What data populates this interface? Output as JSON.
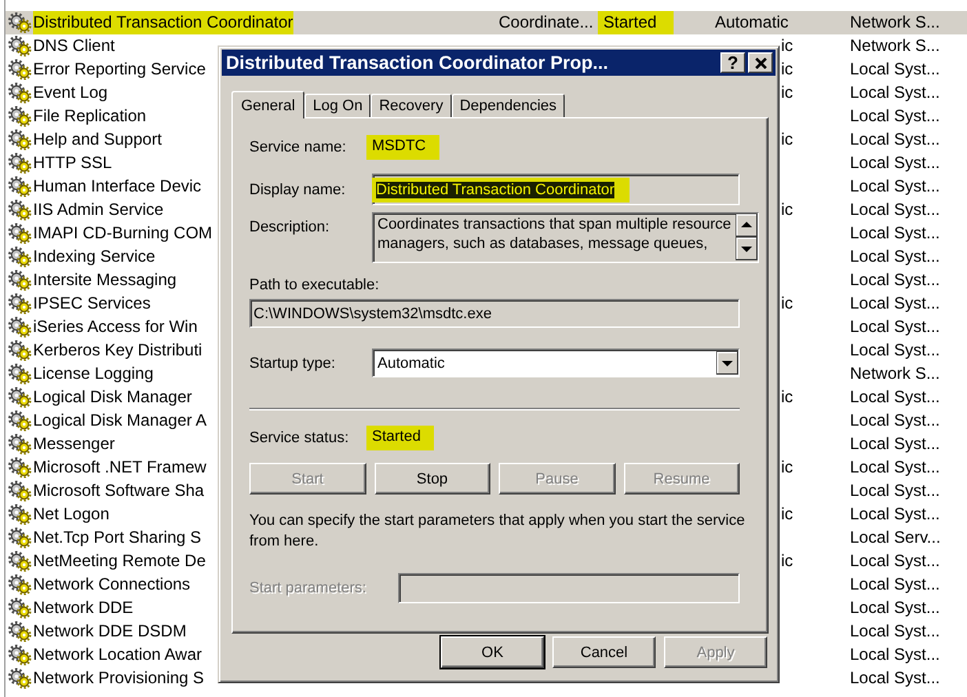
{
  "services": [
    {
      "kind": "full",
      "name": "Distributed Transaction Coordinator",
      "description": "Coordinate...",
      "status": "Started",
      "startup": "Automatic",
      "log_on_as": "Network S...",
      "selected": true,
      "highlighted": true
    },
    {
      "kind": "covered",
      "name": "DNS Client",
      "startup": "ic",
      "log_on_as": "Network S...",
      "selected": false,
      "highlighted": false
    },
    {
      "kind": "covered",
      "name": "Error Reporting Service",
      "startup": "ic",
      "log_on_as": "Local Syst...",
      "selected": false,
      "highlighted": false
    },
    {
      "kind": "covered",
      "name": "Event Log",
      "startup": "ic",
      "log_on_as": "Local Syst...",
      "selected": false,
      "highlighted": false
    },
    {
      "kind": "covered",
      "name": "File Replication",
      "log_on_as": "Local Syst...",
      "selected": false,
      "highlighted": false
    },
    {
      "kind": "covered",
      "name": "Help and Support",
      "startup": "ic",
      "log_on_as": "Local Syst...",
      "selected": false,
      "highlighted": false
    },
    {
      "kind": "covered",
      "name": "HTTP SSL",
      "log_on_as": "Local Syst...",
      "selected": false,
      "highlighted": false
    },
    {
      "kind": "covered",
      "name": "Human Interface Devic",
      "log_on_as": "Local Syst...",
      "selected": false,
      "highlighted": false
    },
    {
      "kind": "covered",
      "name": "IIS Admin Service",
      "startup": "ic",
      "log_on_as": "Local Syst...",
      "selected": false,
      "highlighted": false
    },
    {
      "kind": "covered",
      "name": "IMAPI CD-Burning COM",
      "log_on_as": "Local Syst...",
      "selected": false,
      "highlighted": false
    },
    {
      "kind": "covered",
      "name": "Indexing Service",
      "log_on_as": "Local Syst...",
      "selected": false,
      "highlighted": false
    },
    {
      "kind": "covered",
      "name": "Intersite Messaging",
      "log_on_as": "Local Syst...",
      "selected": false,
      "highlighted": false
    },
    {
      "kind": "covered",
      "name": "IPSEC Services",
      "startup": "ic",
      "log_on_as": "Local Syst...",
      "selected": false,
      "highlighted": false
    },
    {
      "kind": "covered",
      "name": "iSeries Access for Win",
      "log_on_as": "Local Syst...",
      "selected": false,
      "highlighted": false
    },
    {
      "kind": "covered",
      "name": "Kerberos Key Distributi",
      "log_on_as": "Local Syst...",
      "selected": false,
      "highlighted": false
    },
    {
      "kind": "covered",
      "name": "License Logging",
      "log_on_as": "Network S...",
      "selected": false,
      "highlighted": false
    },
    {
      "kind": "covered",
      "name": "Logical Disk Manager",
      "startup": "ic",
      "log_on_as": "Local Syst...",
      "selected": false,
      "highlighted": false
    },
    {
      "kind": "covered",
      "name": "Logical Disk Manager A",
      "log_on_as": "Local Syst...",
      "selected": false,
      "highlighted": false
    },
    {
      "kind": "covered",
      "name": "Messenger",
      "log_on_as": "Local Syst...",
      "selected": false,
      "highlighted": false
    },
    {
      "kind": "covered",
      "name": "Microsoft .NET Framew",
      "startup": "ic",
      "log_on_as": "Local Syst...",
      "selected": false,
      "highlighted": false
    },
    {
      "kind": "covered",
      "name": "Microsoft Software Sha",
      "log_on_as": "Local Syst...",
      "selected": false,
      "highlighted": false
    },
    {
      "kind": "covered",
      "name": "Net Logon",
      "startup": "ic",
      "log_on_as": "Local Syst...",
      "selected": false,
      "highlighted": false
    },
    {
      "kind": "covered",
      "name": "Net.Tcp Port Sharing S",
      "log_on_as": "Local Serv...",
      "selected": false,
      "highlighted": false
    },
    {
      "kind": "covered",
      "name": "NetMeeting Remote De",
      "startup": "ic",
      "log_on_as": "Local Syst...",
      "selected": false,
      "highlighted": false
    },
    {
      "kind": "covered",
      "name": "Network Connections",
      "log_on_as": "Local Syst...",
      "selected": false,
      "highlighted": false
    },
    {
      "kind": "covered",
      "name": "Network DDE",
      "log_on_as": "Local Syst...",
      "selected": false,
      "highlighted": false
    },
    {
      "kind": "covered",
      "name": "Network DDE DSDM",
      "log_on_as": "Local Syst...",
      "selected": false,
      "highlighted": false
    },
    {
      "kind": "covered",
      "name": "Network Location Awar",
      "log_on_as": "Local Syst...",
      "selected": false,
      "highlighted": false
    },
    {
      "kind": "covered",
      "name": "Network Provisioning S",
      "log_on_as": "Local Syst...",
      "selected": false,
      "highlighted": false
    }
  ],
  "dialog": {
    "title": "Distributed Transaction Coordinator Prop...",
    "title_buttons": [
      {
        "kind": "help",
        "label": "?"
      },
      {
        "kind": "close"
      }
    ],
    "tabs": [
      {
        "label": "General",
        "selected": true
      },
      {
        "label": "Log On",
        "selected": false
      },
      {
        "label": "Recovery",
        "selected": false
      },
      {
        "label": "Dependencies",
        "selected": false
      }
    ],
    "service_name": {
      "label": "Service name:",
      "value": "MSDTC",
      "highlighted": true
    },
    "display_name": {
      "label": "Display name:",
      "value": "Distributed Transaction Coordinator",
      "text_selected": true,
      "highlighted": true
    },
    "description": {
      "label": "Description:",
      "lines": [
        "Coordinates transactions that span multiple resource",
        "managers, such as databases, message queues,"
      ]
    },
    "path": {
      "label": "Path to executable:",
      "value": "C:\\WINDOWS\\system32\\msdtc.exe"
    },
    "startup_type": {
      "label": "Startup type:",
      "value": "Automatic"
    },
    "service_status": {
      "label": "Service status:",
      "value": "Started",
      "highlighted": true
    },
    "service_buttons": [
      {
        "label": "Start",
        "disabled": true
      },
      {
        "label": "Stop",
        "disabled": false
      },
      {
        "label": "Pause",
        "disabled": true
      },
      {
        "label": "Resume",
        "disabled": true
      }
    ],
    "hint_lines": [
      "You can specify the start parameters that apply when you start the service",
      "from here."
    ],
    "start_parameters": {
      "label": "Start parameters:",
      "disabled": true
    },
    "footer_buttons": [
      {
        "label": "OK",
        "disabled": false,
        "default": true
      },
      {
        "label": "Cancel",
        "disabled": false,
        "default": false
      },
      {
        "label": "Apply",
        "disabled": true,
        "default": false
      }
    ]
  }
}
